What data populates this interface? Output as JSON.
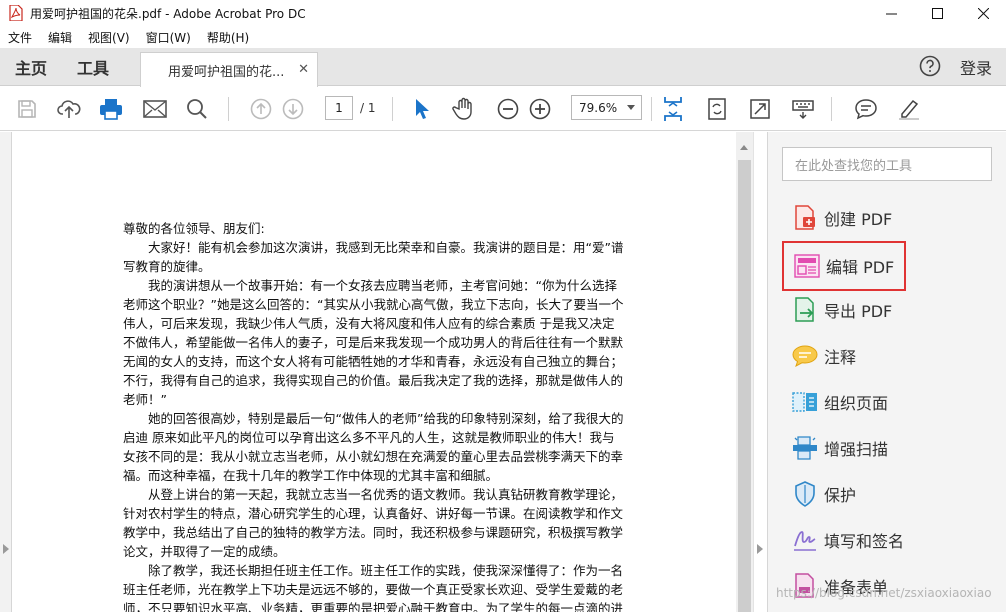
{
  "window": {
    "title": "用爱呵护祖国的花朵.pdf - Adobe Acrobat Pro DC"
  },
  "menu": [
    "文件",
    "编辑",
    "视图(V)",
    "窗口(W)",
    "帮助(H)"
  ],
  "tabs": {
    "home": "主页",
    "tools": "工具",
    "document": "用爱呵护祖国的花...",
    "login": "登录"
  },
  "toolbar": {
    "page_current": "1",
    "page_total": "/ 1",
    "zoom": "79.6%"
  },
  "document": {
    "lines": [
      "尊敬的各位领导、朋友们:",
      "　　大家好！能有机会参加这次演讲，我感到无比荣幸和自豪。我演讲的题目是：用“爱”谱",
      "写教育的旋律。",
      "　　我的演讲想从一个故事开始：有一个女孩去应聘当老师，主考官问她：“你为什么选择",
      "老师这个职业？”她是这么回答的：“其实从小我就心高气傲，我立下志向，长大了要当一个",
      "伟人，可后来发现，我缺少伟人气质，没有大将风度和伟人应有的综合素质 于是我又决定",
      "不做伟人，希望能做一名伟人的妻子，可是后来我发现一个成功男人的背后往往有一个默默",
      "无闻的女人的支持，而这个女人将有可能牺牲她的才华和青春，永远没有自己独立的舞台；",
      "不行，我得有自己的追求，我得实现自己的价值。最后我决定了我的选择，那就是做伟人的",
      "老师！”",
      "　　她的回答很高妙，特别是最后一句“做伟人的老师”给我的印象特别深刻，给了我很大的",
      "启迪 原来如此平凡的岗位可以孕育出这么多不平凡的人生，这就是教师职业的伟大！我与",
      "女孩不同的是：我从小就立志当老师，从小就幻想在充满爱的童心里去品尝桃李满天下的幸",
      "福。而这种幸福，在我十几年的教学工作中体现的尤其丰富和细腻。",
      "　　从登上讲台的第一天起，我就立志当一名优秀的语文教师。我认真钻研教育教学理论，",
      "针对农村学生的特点，潜心研究学生的心理，认真备好、讲好每一节课。在阅读教学和作文",
      "教学中，我总结出了自己的独特的教学方法。同时，我还积极参与课题研究，积极撰写教学",
      "论文，并取得了一定的成绩。",
      "　　除了教学，我还长期担任班主任工作。班主任工作的实践，使我深深懂得了：作为一名",
      "班主任老师，光在教学上下功夫是远远不够的，要做一个真正受家长欢迎、受学生爱戴的老",
      "师，不只要知识水平高、业务精，更重要的是把爱心融于教育中。为了学生的每一点滴的进"
    ]
  },
  "right_panel": {
    "search_placeholder": "在此处查找您的工具",
    "tools": [
      {
        "label": "创建 PDF",
        "icon": "create-pdf-icon",
        "color": "#e0463a"
      },
      {
        "label": "编辑 PDF",
        "icon": "edit-pdf-icon",
        "color": "#e24bb0"
      },
      {
        "label": "导出 PDF",
        "icon": "export-pdf-icon",
        "color": "#2c9d55"
      },
      {
        "label": "注释",
        "icon": "comment-icon",
        "color": "#f0b21b"
      },
      {
        "label": "组织页面",
        "icon": "organize-pages-icon",
        "color": "#37a0d8"
      },
      {
        "label": "增强扫描",
        "icon": "enhance-scan-icon",
        "color": "#2f87c8"
      },
      {
        "label": "保护",
        "icon": "protect-icon",
        "color": "#2f87c8"
      },
      {
        "label": "填写和签名",
        "icon": "fill-sign-icon",
        "color": "#8a6fd2"
      },
      {
        "label": "准备表单",
        "icon": "prepare-form-icon",
        "color": "#c34fa0"
      }
    ],
    "watermark": "https://blog.csdn.net/zsxiaoxiaoxiao"
  },
  "colors": {
    "selection_outline": "#e03333",
    "accent_blue": "#1473e6"
  }
}
